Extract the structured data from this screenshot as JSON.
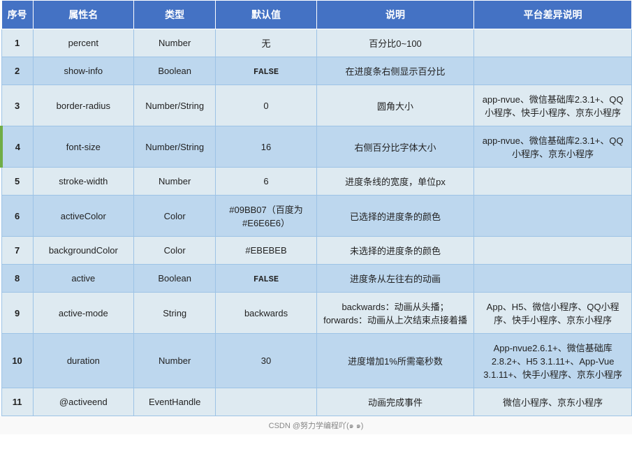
{
  "table": {
    "headers": [
      "序号",
      "属性名",
      "类型",
      "默认值",
      "说明",
      "平台差异说明"
    ],
    "rows": [
      {
        "seq": "1",
        "name": "percent",
        "type": "Number",
        "default": "无",
        "desc": "百分比0~100",
        "platform": "",
        "special": false,
        "defaultCode": false
      },
      {
        "seq": "2",
        "name": "show-info",
        "type": "Boolean",
        "default": "FALSE",
        "desc": "在进度条右侧显示百分比",
        "platform": "",
        "special": false,
        "defaultCode": true
      },
      {
        "seq": "3",
        "name": "border-radius",
        "type": "Number/String",
        "default": "0",
        "desc": "圆角大小",
        "platform": "app-nvue、微信基础库2.3.1+、QQ小程序、快手小程序、京东小程序",
        "special": false,
        "defaultCode": false
      },
      {
        "seq": "4",
        "name": "font-size",
        "type": "Number/String",
        "default": "16",
        "desc": "右侧百分比字体大小",
        "platform": "app-nvue、微信基础库2.3.1+、QQ小程序、京东小程序",
        "special": true,
        "defaultCode": false
      },
      {
        "seq": "5",
        "name": "stroke-width",
        "type": "Number",
        "default": "6",
        "desc": "进度条线的宽度，单位px",
        "platform": "",
        "special": false,
        "defaultCode": false
      },
      {
        "seq": "6",
        "name": "activeColor",
        "type": "Color",
        "default": "#09BB07（百度为#E6E6E6）",
        "desc": "已选择的进度条的颜色",
        "platform": "",
        "special": false,
        "defaultCode": false
      },
      {
        "seq": "7",
        "name": "backgroundColor",
        "type": "Color",
        "default": "#EBEBEB",
        "desc": "未选择的进度条的颜色",
        "platform": "",
        "special": false,
        "defaultCode": false
      },
      {
        "seq": "8",
        "name": "active",
        "type": "Boolean",
        "default": "FALSE",
        "desc": "进度条从左往右的动画",
        "platform": "",
        "special": false,
        "defaultCode": true
      },
      {
        "seq": "9",
        "name": "active-mode",
        "type": "String",
        "default": "backwards",
        "desc": "backwards：动画从头播；forwards：动画从上次结束点接着播",
        "platform": "App、H5、微信小程序、QQ小程序、快手小程序、京东小程序",
        "special": false,
        "defaultCode": false
      },
      {
        "seq": "10",
        "name": "duration",
        "type": "Number",
        "default": "30",
        "desc": "进度增加1%所需毫秒数",
        "platform": "App-nvue2.6.1+、微信基础库2.8.2+、H5 3.1.11+、App-Vue 3.1.11+、快手小程序、京东小程序",
        "special": false,
        "defaultCode": false
      },
      {
        "seq": "11",
        "name": "@activeend",
        "type": "EventHandle",
        "default": "",
        "desc": "动画完成事件",
        "platform": "微信小程序、京东小程序",
        "special": false,
        "defaultCode": false
      }
    ]
  },
  "footer": {
    "text": "CSDN @努力学编程吖(๑ ๑)"
  }
}
